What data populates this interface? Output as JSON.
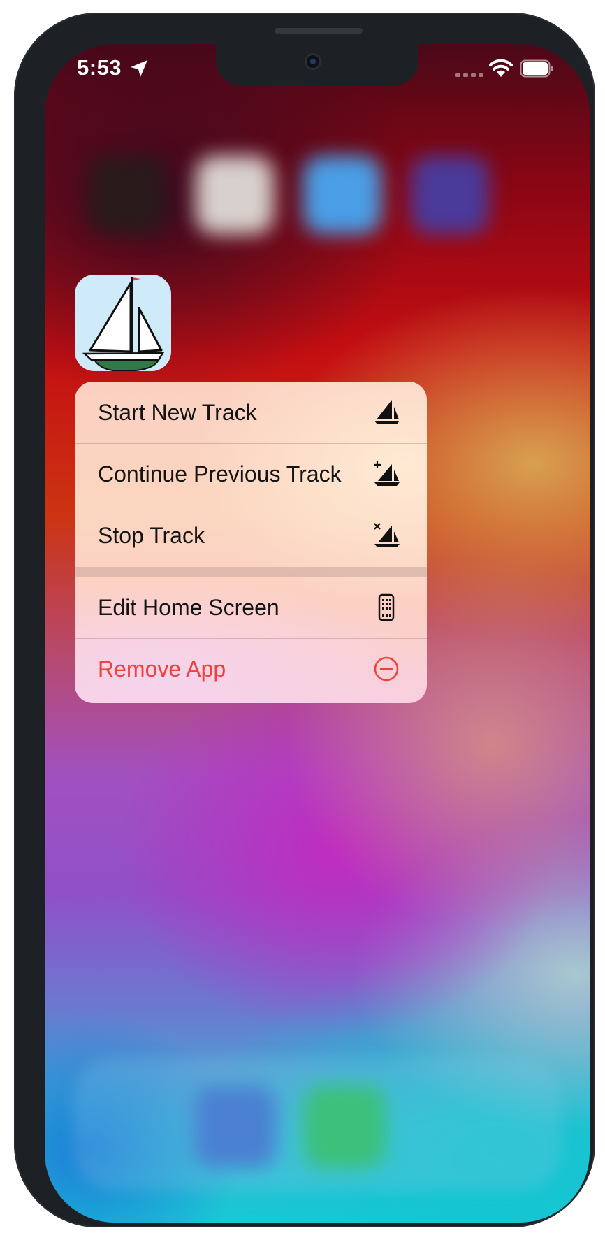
{
  "status_bar": {
    "time": "5:53",
    "location_icon": "location-arrow-icon",
    "signal_icon": "cellular-signal-icon",
    "wifi_icon": "wifi-icon",
    "battery_icon": "battery-full-icon"
  },
  "app": {
    "icon": "sailboat-app-icon"
  },
  "context_menu": {
    "items": [
      {
        "label": "Start New Track",
        "icon": "sailboat-icon"
      },
      {
        "label": "Continue Previous Track",
        "icon": "sailboat-plus-icon"
      },
      {
        "label": "Stop Track",
        "icon": "sailboat-x-icon"
      },
      {
        "label": "Edit Home Screen",
        "icon": "phone-apps-icon"
      },
      {
        "label": "Remove App",
        "icon": "minus-circle-icon",
        "color": "#f0403a"
      }
    ]
  },
  "colors": {
    "destructive": "#f0403a",
    "frame": "#1d2024",
    "app_icon_background": "#cfeaf8"
  }
}
